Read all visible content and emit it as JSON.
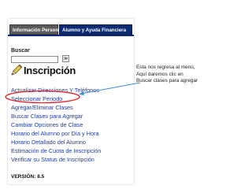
{
  "tabs": [
    {
      "label": "Información Personal",
      "active": false
    },
    {
      "label": "Alumno y Ayuda Financiera",
      "active": true
    }
  ],
  "search": {
    "label": "Buscar",
    "value": "",
    "button_label": "≫"
  },
  "page_title": "Inscripción",
  "menu": {
    "items": [
      {
        "label": "Actualizar Direcciones Y Teléfonos"
      },
      {
        "label": "Seleccionar Periodo"
      },
      {
        "label": "Agregar/Eliminar Clases"
      },
      {
        "label": "Buscar Clases para Agregar",
        "highlighted": true
      },
      {
        "label": "Cambiar Opciones de Clase"
      },
      {
        "label": "Horario del Alumno por Día y Hora"
      },
      {
        "label": "Horario Detallado del Alumno"
      },
      {
        "label": "Estimación de Cuota de Inscripción"
      },
      {
        "label": "Verificar su Status de Inscripción"
      }
    ]
  },
  "version": "VERSIÓN: 8.5",
  "callout": {
    "line1": "Esta nos regresa al menú,",
    "line2": "Aquí daremos clic en",
    "line3": "Buscar clases para agregar"
  },
  "colors": {
    "tab_active": "#0c2b72",
    "tab_inactive": "#5a5a5a",
    "link": "#1f3ca8",
    "annotation": "#e0252d"
  },
  "icons": {
    "title_icon": "pencil-icon",
    "search_go": "double-chevron-icon"
  }
}
